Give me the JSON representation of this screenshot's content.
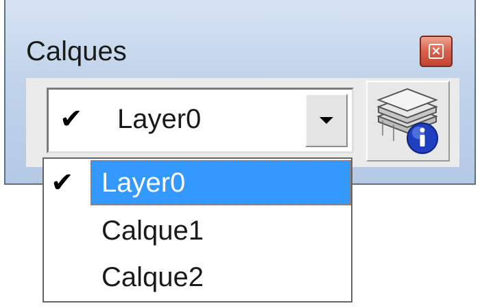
{
  "window": {
    "title": "Calques",
    "close_icon": "close-icon"
  },
  "layer_combo": {
    "selected_check": "✔",
    "selected_value": "Layer0",
    "dropdown_icon": "chevron-down-icon"
  },
  "layer_manager_button": {
    "icon": "layers-info-icon"
  },
  "dropdown": {
    "items": [
      {
        "label": "Layer0",
        "checked": true,
        "check": "✔",
        "highlighted": true
      },
      {
        "label": "Calque1",
        "checked": false,
        "check": "",
        "highlighted": false
      },
      {
        "label": "Calque2",
        "checked": false,
        "check": "",
        "highlighted": false
      }
    ]
  },
  "colors": {
    "selection_highlight": "#3399ff",
    "close_button": "#d8604a",
    "title_bar_gradient_top": "#d6e3f2",
    "title_bar_gradient_bottom": "#b4c9e4"
  }
}
